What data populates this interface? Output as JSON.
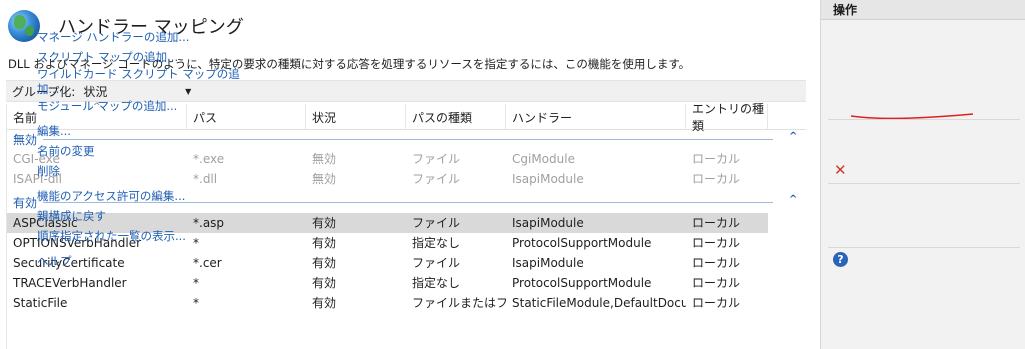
{
  "header": {
    "title": "ハンドラー マッピング",
    "icon": "globe-icon"
  },
  "description": "DLL およびマネージ コードのように、特定の要求の種類に対する応答を処理するリソースを指定するには、この機能を使用します。",
  "toolbar": {
    "groupby_label": "グループ化:",
    "groupby_value": "状況"
  },
  "columns": [
    "名前",
    "パス",
    "状況",
    "パスの種類",
    "ハンドラー",
    "エントリの種類"
  ],
  "groups": [
    {
      "label": "無効",
      "rows": [
        [
          "CGI-exe",
          "*.exe",
          "無効",
          "ファイル",
          "CgiModule",
          "ローカル"
        ],
        [
          "ISAPI-dll",
          "*.dll",
          "無効",
          "ファイル",
          "IsapiModule",
          "ローカル"
        ]
      ]
    },
    {
      "label": "有効",
      "rows": [
        [
          "ASPClassic",
          "*.asp",
          "有効",
          "ファイル",
          "IsapiModule",
          "ローカル"
        ],
        [
          "OPTIONSVerbHandler",
          "*",
          "有効",
          "指定なし",
          "ProtocolSupportModule",
          "ローカル"
        ],
        [
          "SecurityCertificate",
          "*.cer",
          "有効",
          "ファイル",
          "IsapiModule",
          "ローカル"
        ],
        [
          "TRACEVerbHandler",
          "*",
          "有効",
          "指定なし",
          "ProtocolSupportModule",
          "ローカル"
        ],
        [
          "StaticFile",
          "*",
          "有効",
          "ファイルまたはフ...",
          "StaticFileModule,DefaultDocu...",
          "ローカル"
        ]
      ]
    }
  ],
  "actions": {
    "title": "操作",
    "items": [
      "マネージ ハンドラーの追加...",
      "スクリプト マップの追加...",
      "ワイルドカード スクリプト マップの追",
      "加...",
      "モジュール マップの追加...",
      "編集...",
      "名前の変更",
      "削除",
      "機能のアクセス許可の編集...",
      "親構成に戻す",
      "順序指定された一覧の表示...",
      "ヘルプ"
    ]
  },
  "colors": {
    "link": "#1f5fb4",
    "group": "#1e5db0",
    "selected_row": "#d9d9d9",
    "annotation": "#e02020"
  }
}
